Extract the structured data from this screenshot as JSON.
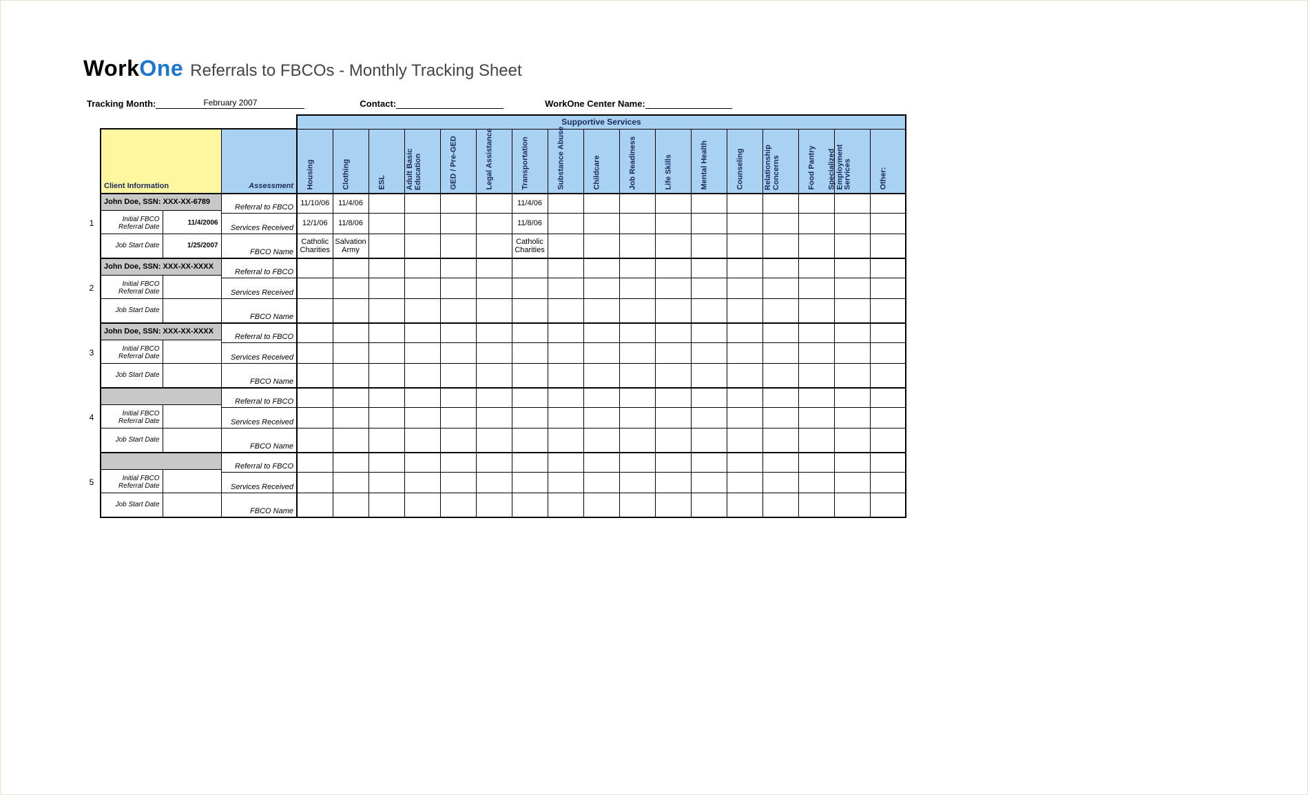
{
  "logo": {
    "part1": "Work",
    "part2": "One"
  },
  "subtitle": "Referrals to FBCOs - Monthly Tracking Sheet",
  "meta": {
    "tracking_month_label": "Tracking Month:",
    "tracking_month_value": "February 2007",
    "contact_label": "Contact:",
    "contact_value": "",
    "center_label": "WorkOne Center Name:",
    "center_value": ""
  },
  "labels": {
    "supportive_services": "Supportive Services",
    "client_info": "Client Information",
    "assessment": "Assessment",
    "initial_referral": "Initial FBCO Referral Date",
    "job_start": "Job Start Date",
    "r1": "Referral to FBCO",
    "r2": "Services Received",
    "r3": "FBCO Name"
  },
  "services": [
    "Housing",
    "Clothing",
    "ESL",
    "Adult Basic\nEducation",
    "GED / Pre-GED",
    "Legal Assistance",
    "Transportation",
    "Substance Abuse",
    "Childcare",
    "Job Readiness",
    "Life Skills",
    "Mental Health",
    "Counseling",
    "Relationship\nConcerns",
    "Food Pantry",
    "Specialized\nEmployment\nServices",
    "Other:"
  ],
  "blocks": [
    {
      "num": "1",
      "name": "John Doe, SSN: XXX-XX-6789",
      "initial_date": "11/4/2006",
      "job_start": "1/25/2007",
      "rows": [
        {
          "cells": [
            "11/10/06",
            "11/4/06",
            "",
            "",
            "",
            "",
            "11/4/06",
            "",
            "",
            "",
            "",
            "",
            "",
            "",
            "",
            "",
            ""
          ]
        },
        {
          "cells": [
            "12/1/06",
            "11/8/06",
            "",
            "",
            "",
            "",
            "11/8/06",
            "",
            "",
            "",
            "",
            "",
            "",
            "",
            "",
            "",
            ""
          ]
        },
        {
          "cells": [
            "Catholic Charities",
            "Salvation Army",
            "",
            "",
            "",
            "",
            "Catholic Charities",
            "",
            "",
            "",
            "",
            "",
            "",
            "",
            "",
            "",
            ""
          ]
        }
      ]
    },
    {
      "num": "2",
      "name": "John Doe, SSN: XXX-XX-XXXX",
      "initial_date": "",
      "job_start": "",
      "rows": [
        {
          "cells": [
            "",
            "",
            "",
            "",
            "",
            "",
            "",
            "",
            "",
            "",
            "",
            "",
            "",
            "",
            "",
            "",
            ""
          ]
        },
        {
          "cells": [
            "",
            "",
            "",
            "",
            "",
            "",
            "",
            "",
            "",
            "",
            "",
            "",
            "",
            "",
            "",
            "",
            ""
          ]
        },
        {
          "cells": [
            "",
            "",
            "",
            "",
            "",
            "",
            "",
            "",
            "",
            "",
            "",
            "",
            "",
            "",
            "",
            "",
            ""
          ]
        }
      ]
    },
    {
      "num": "3",
      "name": "John Doe, SSN: XXX-XX-XXXX",
      "initial_date": "",
      "job_start": "",
      "rows": [
        {
          "cells": [
            "",
            "",
            "",
            "",
            "",
            "",
            "",
            "",
            "",
            "",
            "",
            "",
            "",
            "",
            "",
            "",
            ""
          ]
        },
        {
          "cells": [
            "",
            "",
            "",
            "",
            "",
            "",
            "",
            "",
            "",
            "",
            "",
            "",
            "",
            "",
            "",
            "",
            ""
          ]
        },
        {
          "cells": [
            "",
            "",
            "",
            "",
            "",
            "",
            "",
            "",
            "",
            "",
            "",
            "",
            "",
            "",
            "",
            "",
            ""
          ]
        }
      ]
    },
    {
      "num": "4",
      "name": "",
      "initial_date": "",
      "job_start": "",
      "rows": [
        {
          "cells": [
            "",
            "",
            "",
            "",
            "",
            "",
            "",
            "",
            "",
            "",
            "",
            "",
            "",
            "",
            "",
            "",
            ""
          ]
        },
        {
          "cells": [
            "",
            "",
            "",
            "",
            "",
            "",
            "",
            "",
            "",
            "",
            "",
            "",
            "",
            "",
            "",
            "",
            ""
          ]
        },
        {
          "cells": [
            "",
            "",
            "",
            "",
            "",
            "",
            "",
            "",
            "",
            "",
            "",
            "",
            "",
            "",
            "",
            "",
            ""
          ]
        }
      ]
    },
    {
      "num": "5",
      "name": "",
      "initial_date": "",
      "job_start": "",
      "rows": [
        {
          "cells": [
            "",
            "",
            "",
            "",
            "",
            "",
            "",
            "",
            "",
            "",
            "",
            "",
            "",
            "",
            "",
            "",
            ""
          ]
        },
        {
          "cells": [
            "",
            "",
            "",
            "",
            "",
            "",
            "",
            "",
            "",
            "",
            "",
            "",
            "",
            "",
            "",
            "",
            ""
          ]
        },
        {
          "cells": [
            "",
            "",
            "",
            "",
            "",
            "",
            "",
            "",
            "",
            "",
            "",
            "",
            "",
            "",
            "",
            "",
            ""
          ]
        }
      ]
    }
  ]
}
